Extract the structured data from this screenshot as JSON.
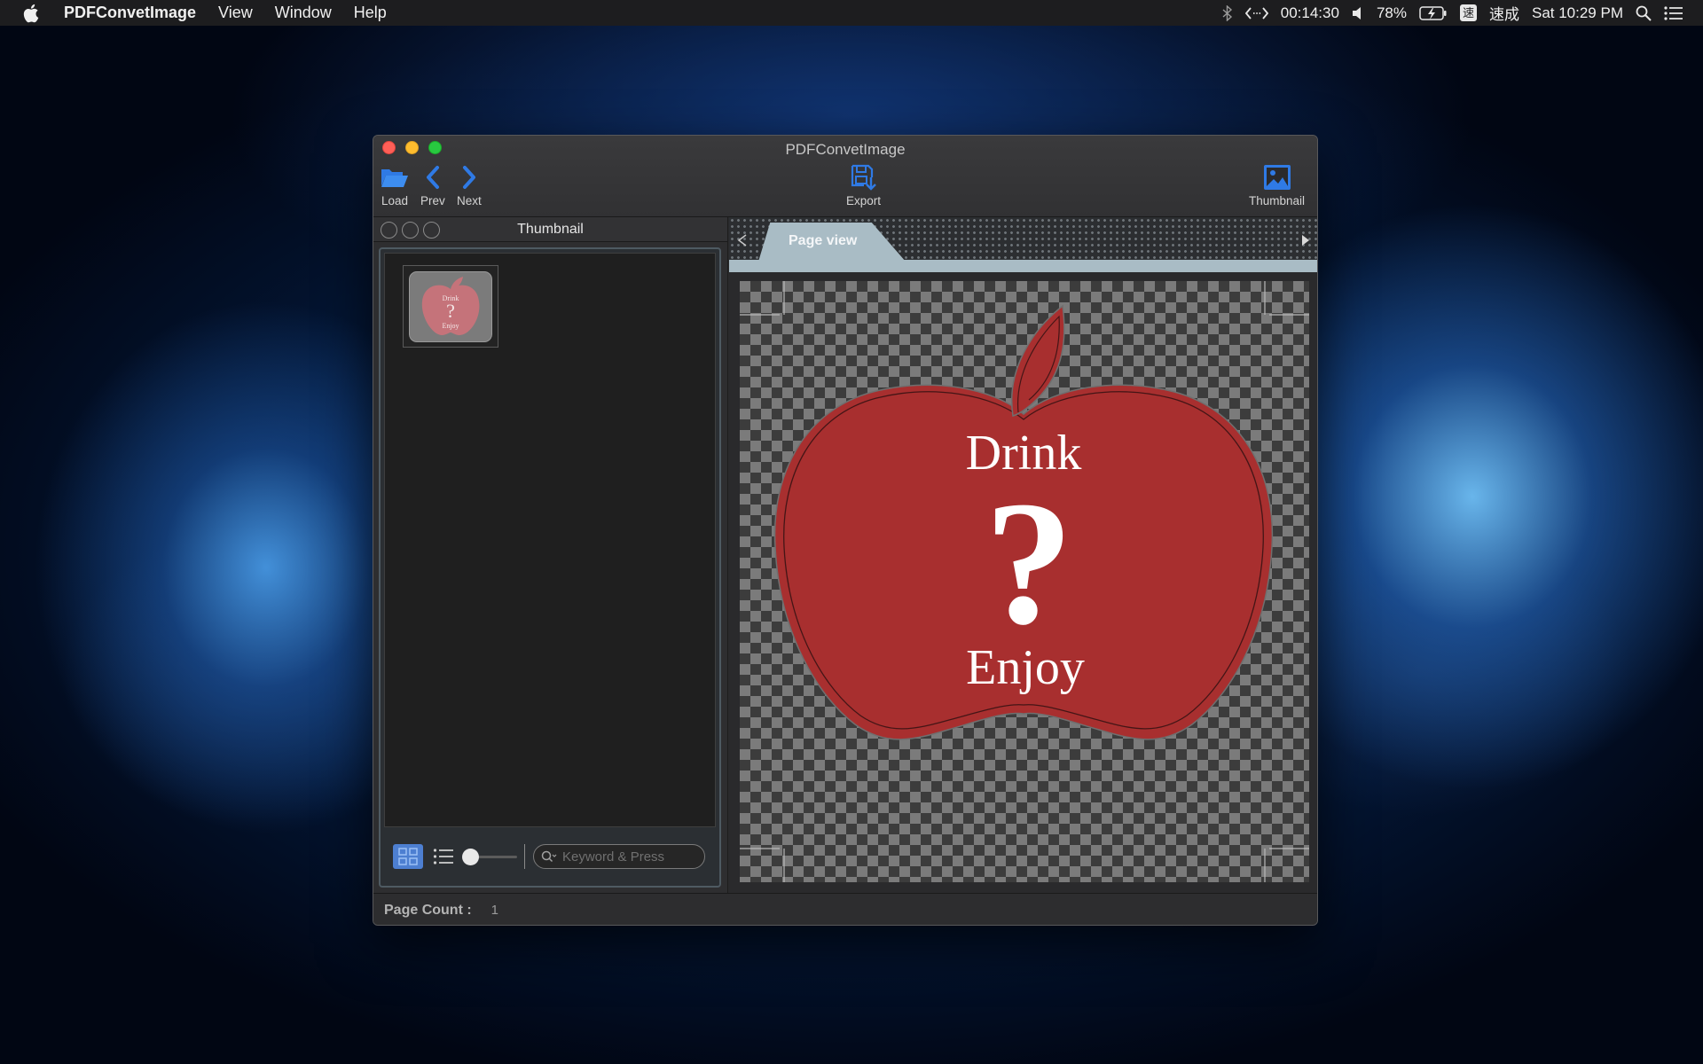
{
  "menubar": {
    "app_name": "PDFConvetImage",
    "items": [
      "View",
      "Window",
      "Help"
    ],
    "timer": "00:14:30",
    "battery": "78%",
    "ime_badge": "速",
    "ime_label": "速成",
    "clock": "Sat 10:29 PM"
  },
  "window": {
    "title": "PDFConvetImage",
    "toolbar": {
      "load": "Load",
      "prev": "Prev",
      "next": "Next",
      "export": "Export",
      "thumbnail": "Thumbnail"
    },
    "accent_color": "#2f7ae5"
  },
  "thumbnail_panel": {
    "title": "Thumbnail",
    "thumb_text": {
      "top": "Drink",
      "mark": "?",
      "bottom": "Enjoy"
    },
    "search_placeholder": "Keyword & Press",
    "zoom_level": 0
  },
  "page_view": {
    "tab_label": "Page view",
    "page_text": {
      "top": "Drink",
      "mark": "?",
      "bottom": "Enjoy"
    },
    "apple_color": "#a82f2f"
  },
  "statusbar": {
    "page_count_label": "Page Count :",
    "page_count_value": "1"
  }
}
